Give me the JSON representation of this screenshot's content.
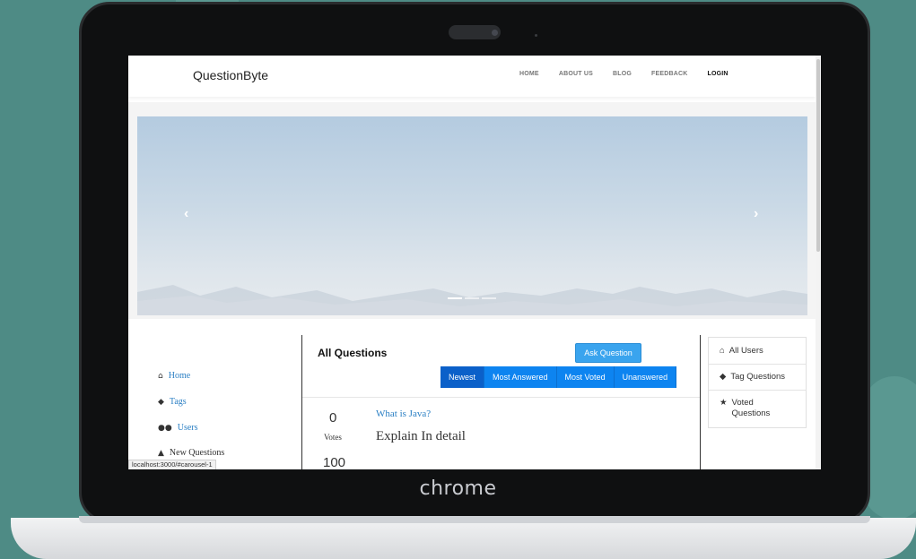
{
  "device": {
    "brand_text": "chrome"
  },
  "navbar": {
    "brand": "QuestionByte",
    "links": [
      "HOME",
      "ABOUT US",
      "BLOG",
      "FEEDBACK",
      "LOGIN"
    ]
  },
  "carousel": {
    "prev_icon": "chevron-left-icon",
    "next_icon": "chevron-right-icon"
  },
  "sidebar": {
    "items": [
      {
        "label": "Home",
        "icon": "home-icon",
        "glyph": "🏠"
      },
      {
        "label": "Tags",
        "icon": "tags-icon",
        "glyph": "🏷"
      },
      {
        "label": "Users",
        "icon": "users-icon",
        "glyph": "👥"
      },
      {
        "label": "New Questions",
        "icon": "new-questions-icon",
        "glyph": "📝"
      }
    ]
  },
  "main": {
    "title": "All Questions",
    "ask_button": "Ask Question",
    "tabs": [
      "Newest",
      "Most Answered",
      "Most Voted",
      "Unanswered"
    ],
    "question": {
      "votes": "0",
      "votes_label": "Votes",
      "answers": "100",
      "title": "What is Java?",
      "description": "Explain In detail"
    }
  },
  "right_panel": {
    "items": [
      {
        "label": "All Users",
        "icon": "home-icon"
      },
      {
        "label": "Tag Questions",
        "icon": "tags-icon"
      },
      {
        "label": "Voted Questions",
        "icon": "star-icon"
      }
    ]
  },
  "status_bar": {
    "url": "localhost:3000/#carousel-1"
  },
  "colors": {
    "accent": "#0d84f0",
    "link": "#2a7fc4",
    "background": "#4e8b85"
  }
}
